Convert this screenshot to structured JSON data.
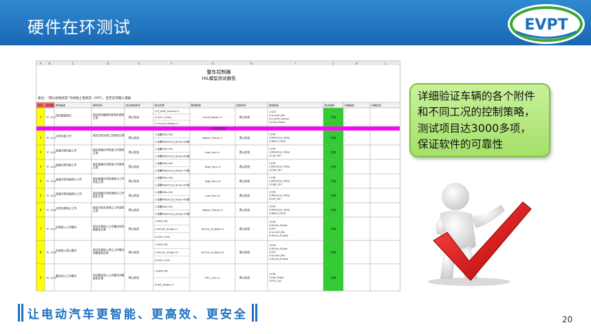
{
  "slide": {
    "title": "硬件在环测试",
    "logo_text": "EVPT",
    "page_number": "20",
    "slogan": "让电动汽车更智能、更高效、更安全",
    "colors": {
      "header": "#1f70bd",
      "accent_green": "#a5e06a",
      "pass_green": "#33cc33",
      "section_magenta": "#ff00ff",
      "yellow": "#ffff00"
    }
  },
  "callout": {
    "line1": "详细验证车辆的各个附件",
    "line2": "和不同工况的控制策略，",
    "line3a": "测试项目达",
    "line3b": "3000",
    "line3c": "多项，",
    "line4": "保证软件的可靠性"
  },
  "figure": {
    "icon": "person-checkmark-icon"
  },
  "sheet": {
    "column_letters": [
      "A",
      "B",
      "C",
      "D",
      "E",
      "F",
      "G",
      "H",
      "I",
      "J",
      "K",
      "L"
    ],
    "report_title": "整车控制器",
    "report_subtitle": "HIL模型测试报告",
    "note": "备注：“默认初始状态”为初始上电状态（OFF），且无任何输入激励",
    "headers": [
      "序号",
      "用例编号",
      "用例描述",
      "用例目的",
      "自动控制条件",
      "测试步骤",
      "期望结果",
      "结束条件",
      "观测变量",
      "测试结果",
      "问题描述",
      "问题反馈"
    ],
    "first_row": {
      "no": "1",
      "id": "TC 13-1",
      "desc": "挡位解锁测试",
      "purpose": "验证挡位解锁判定条件是否正常",
      "cond": "默认状态",
      "steps": [
        "1.Q_shift_Control=1",
        "2.SOC=100%",
        "3.VcuCtrl_Ready=1"
      ],
      "expect": "Limit_Power=1",
      "end": "默认状态",
      "obs": [
        "1.SOC",
        "2.VcuCtrl_Mix",
        "3.Q_shift_Control",
        "4.Limit_Power"
      ],
      "result": "合格"
    },
    "section_label": "冷却控制测试",
    "rows": [
      {
        "no": "1",
        "id": "TC 14-1",
        "desc": "冷却水泵工作",
        "purpose": "验证冷却水泵工作是否正常",
        "cond": "默认状态",
        "steps": [
          "1.设置IGN=ON",
          "2.设置MotorCoo_Temp=60度"
        ],
        "expect": "Water_Pump=1",
        "end": "默认状态",
        "obs": [
          "1.IGN",
          "2.MotorCoo_Temp",
          "3.Water_Pump"
        ],
        "result": "合格"
      },
      {
        "no": "2",
        "id": "TC 14-2",
        "desc": "低速冷却风扇工作",
        "purpose": "验证低速冷却风扇工作是否正常",
        "cond": "默认状态",
        "steps": [
          "1.设置IGN=ON",
          "2.设置MotorCoo_Temp=65度"
        ],
        "expect": "Low_Fan=1",
        "end": "默认状态",
        "obs": [
          "1.IGN",
          "2.MotorCoo_Temp",
          "3.Low_Fan"
        ],
        "result": "合格"
      },
      {
        "no": "3",
        "id": "TC 14-3",
        "desc": "高速冷却风扇工作",
        "purpose": "验证高速冷却风扇工作是否正常",
        "cond": "默认状态",
        "steps": [
          "1.设置IGN=ON",
          "2.设置MotorCoo_Temp=70度"
        ],
        "expect": "High_Fan=1",
        "end": "默认状态",
        "obs": [
          "1.IGN",
          "2.MotorCoo_Temp",
          "3.High_Fan"
        ],
        "result": "合格"
      },
      {
        "no": "4",
        "id": "TC 14-4",
        "desc": "高速冷却风扇停止工作",
        "purpose": "验证高速冷却风扇停止工作是否正常",
        "cond": "默认状态",
        "steps": [
          "1.设置IGN=ON",
          "2.设置MotorCoo_Temp=65度"
        ],
        "expect": "High_Fan=0",
        "end": "默认状态",
        "obs": [
          "1.IGN",
          "2.MotorCoo_Temp",
          "3.High_Fan"
        ],
        "result": "合格"
      },
      {
        "no": "5",
        "id": "TC 14-5",
        "desc": "低速冷却风扇停止工作",
        "purpose": "验证低速冷却风扇停止工作是否正常",
        "cond": "默认状态",
        "steps": [
          "1.设置IGN=ON",
          "2.设置MotorCoo_Temp=60度"
        ],
        "expect": "Low_Fan=0",
        "end": "默认状态",
        "obs": [
          "1.IGN",
          "2.MotorCoo_Temp",
          "3.Low_Fan"
        ],
        "result": "合格"
      },
      {
        "no": "6",
        "id": "TC 14-6",
        "desc": "冷却水泵停止工作",
        "purpose": "验证冷却水泵停止工作是否正常",
        "cond": "默认状态",
        "steps": [
          "1.设置IGN=ON",
          "2.设置MotorCoo_Temp=45度"
        ],
        "expect": "Water_Pump=0",
        "end": "默认状态",
        "obs": [
          "1.IGN",
          "2.MotorCoo_Temp",
          "3.Water_Pump"
        ],
        "result": "合格"
      },
      {
        "no": "7",
        "id": "TC 14-7",
        "desc": "空调进入工作模式",
        "purpose": "验证空调进入工作模式的判断是否正常",
        "cond": "默认状态",
        "steps": [
          "1.IGN=ON",
          "2.AirCon_Single=1",
          "3.SOC=10%"
        ],
        "expect": "AirCon_Enable=1",
        "end": "默认状态",
        "obs": [
          "1.IGN",
          "2.AirCon_Single",
          "3.SOC",
          "4.VcuCtrl_Mix",
          "5.AirCon_Enable"
        ],
        "result": "合格"
      },
      {
        "no": "8",
        "id": "TC 14-8",
        "desc": "空调进入停止模式",
        "purpose": "验证空调进入停止工作模式判断是否正常",
        "cond": "默认状态",
        "steps": [
          "1.IGN=ON",
          "2.AirCon_Single=0",
          "3.SOC=10%"
        ],
        "expect": "AirCon_Enable=0",
        "end": "默认状态",
        "obs": [
          "1.IGN",
          "2.AirCon_Single",
          "3.SOC",
          "4.VcuCtrl_Mix",
          "5.AirCon_Enable"
        ],
        "result": "合格"
      },
      {
        "no": "9",
        "id": "TC 14-9",
        "desc": "暖风进入工作模式",
        "purpose": "验证暖风进入工作模式判断是否正常",
        "cond": "默认状态",
        "steps": [
          "1.IGN=ON",
          "2.Hot_Single=1"
        ],
        "expect": "PTC_Con=1",
        "end": "默认状态",
        "obs": [
          "1.IGN",
          "2.Hot_Single",
          "3.PTC_Con"
        ],
        "result": "合格"
      }
    ]
  }
}
